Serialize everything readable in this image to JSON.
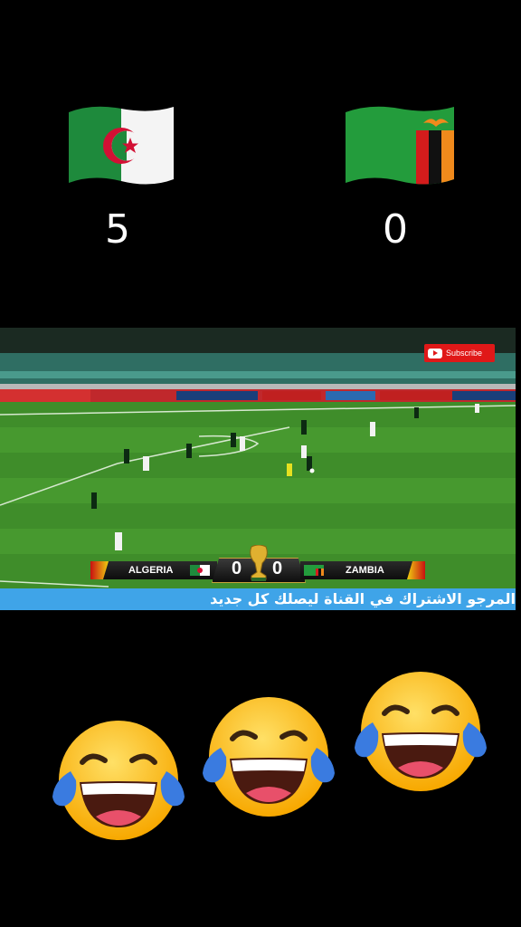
{
  "header": {
    "home": {
      "team": "Algeria",
      "flag_icon": "algeria-flag-icon",
      "score": "5"
    },
    "away": {
      "team": "Zambia",
      "flag_icon": "zambia-flag-icon",
      "score": "0"
    }
  },
  "video": {
    "subscribe_label": "Subscribe",
    "scorebug": {
      "home_team": "ALGERIA",
      "home_goals": "0",
      "away_goals": "0",
      "away_team": "ZAMBIA"
    },
    "ticker_text": "المرجو الاشتراك في القناة ليصلك كل جديد"
  },
  "reactions": {
    "icon": "face-with-tears-of-joy-icon",
    "count": 3
  },
  "colors": {
    "background": "#000000",
    "pitch": "#3f8d2a",
    "ticker": "#3fa4e8",
    "subscribe": "#e01818"
  }
}
